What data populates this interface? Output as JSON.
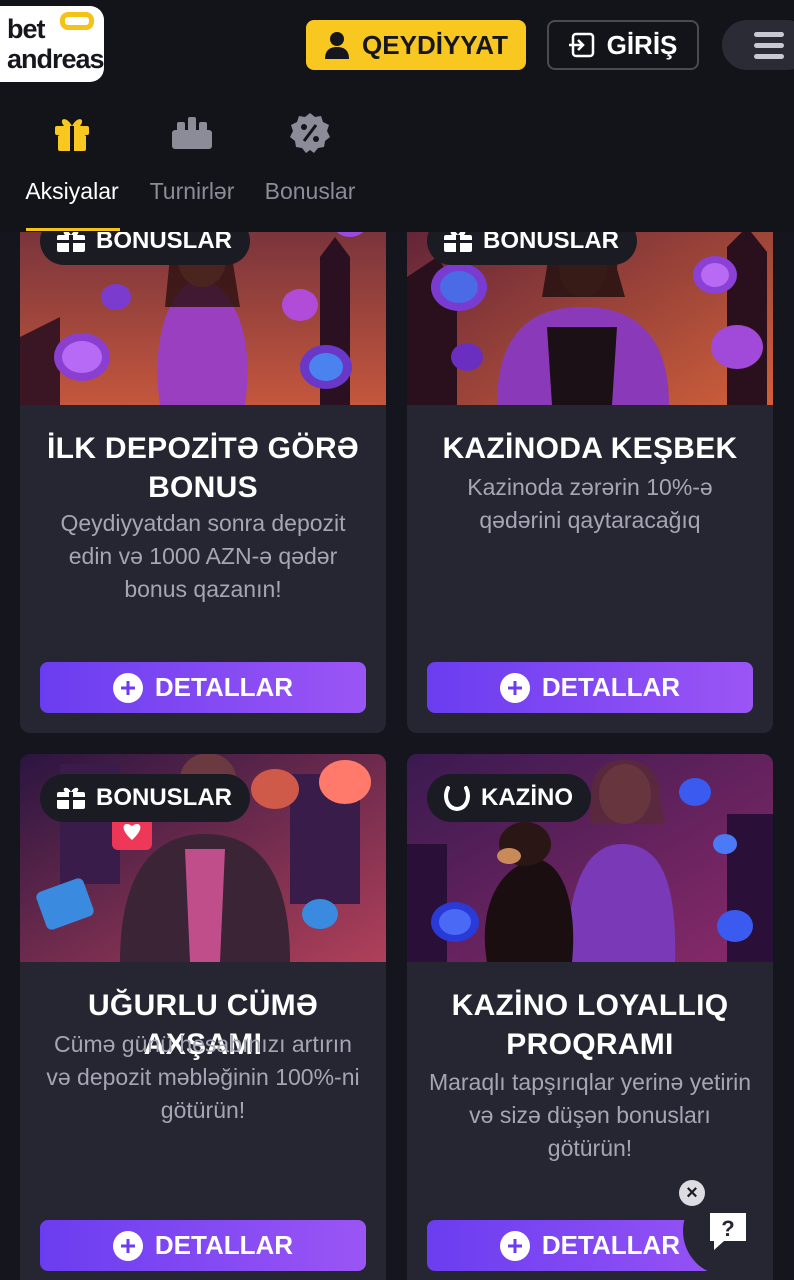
{
  "brand": {
    "line1": "bet",
    "line2": "andreas"
  },
  "header": {
    "register_label": "QEYDİYYAT",
    "login_label": "GİRİŞ"
  },
  "tabs": [
    {
      "label": "Aksiyalar",
      "icon": "gift-icon",
      "active": true
    },
    {
      "label": "Turnirlər",
      "icon": "tournament-icon",
      "active": false
    },
    {
      "label": "Bonuslar",
      "icon": "percent-badge-icon",
      "active": false
    }
  ],
  "cards": [
    {
      "tag": "BONUSLAR",
      "tag_icon": "gift-icon",
      "title": "İLK DEPOZİTƏ GÖRƏ BONUS",
      "description": "Qeydiyyatdan sonra depozit edin və 1000 AZN-ə qədər bonus qazanın!",
      "button": "DETALLAR"
    },
    {
      "tag": "BONUSLAR",
      "tag_icon": "gift-icon",
      "title": "KAZİNODA KEŞBEK",
      "description": "Kazinoda zərərin 10%-ə qədərini qaytaracağıq",
      "button": "DETALLAR"
    },
    {
      "tag": "BONUSLAR",
      "tag_icon": "gift-icon",
      "title": "UĞURLU CÜMƏ AXŞAMI",
      "description": "Cümə günü hesabınızı artırın və depozit məbləğinin 100%-ni götürün!",
      "button": "DETALLAR"
    },
    {
      "tag": "KAZİNO",
      "tag_icon": "horseshoe-icon",
      "title": "KAZİNO LOYALLIQ PROQRAMI",
      "description": "Maraqlı tapşırıqlar yerinə yetirin və sizə düşən bonusları götürün!",
      "button": "DETALLAR"
    }
  ],
  "chat": {
    "icon": "question-chat-icon",
    "label": "?"
  },
  "colors": {
    "accent_yellow": "#f8c820",
    "button_purple": "#7c44f2",
    "card_bg": "#262633",
    "page_bg": "#15151d"
  }
}
